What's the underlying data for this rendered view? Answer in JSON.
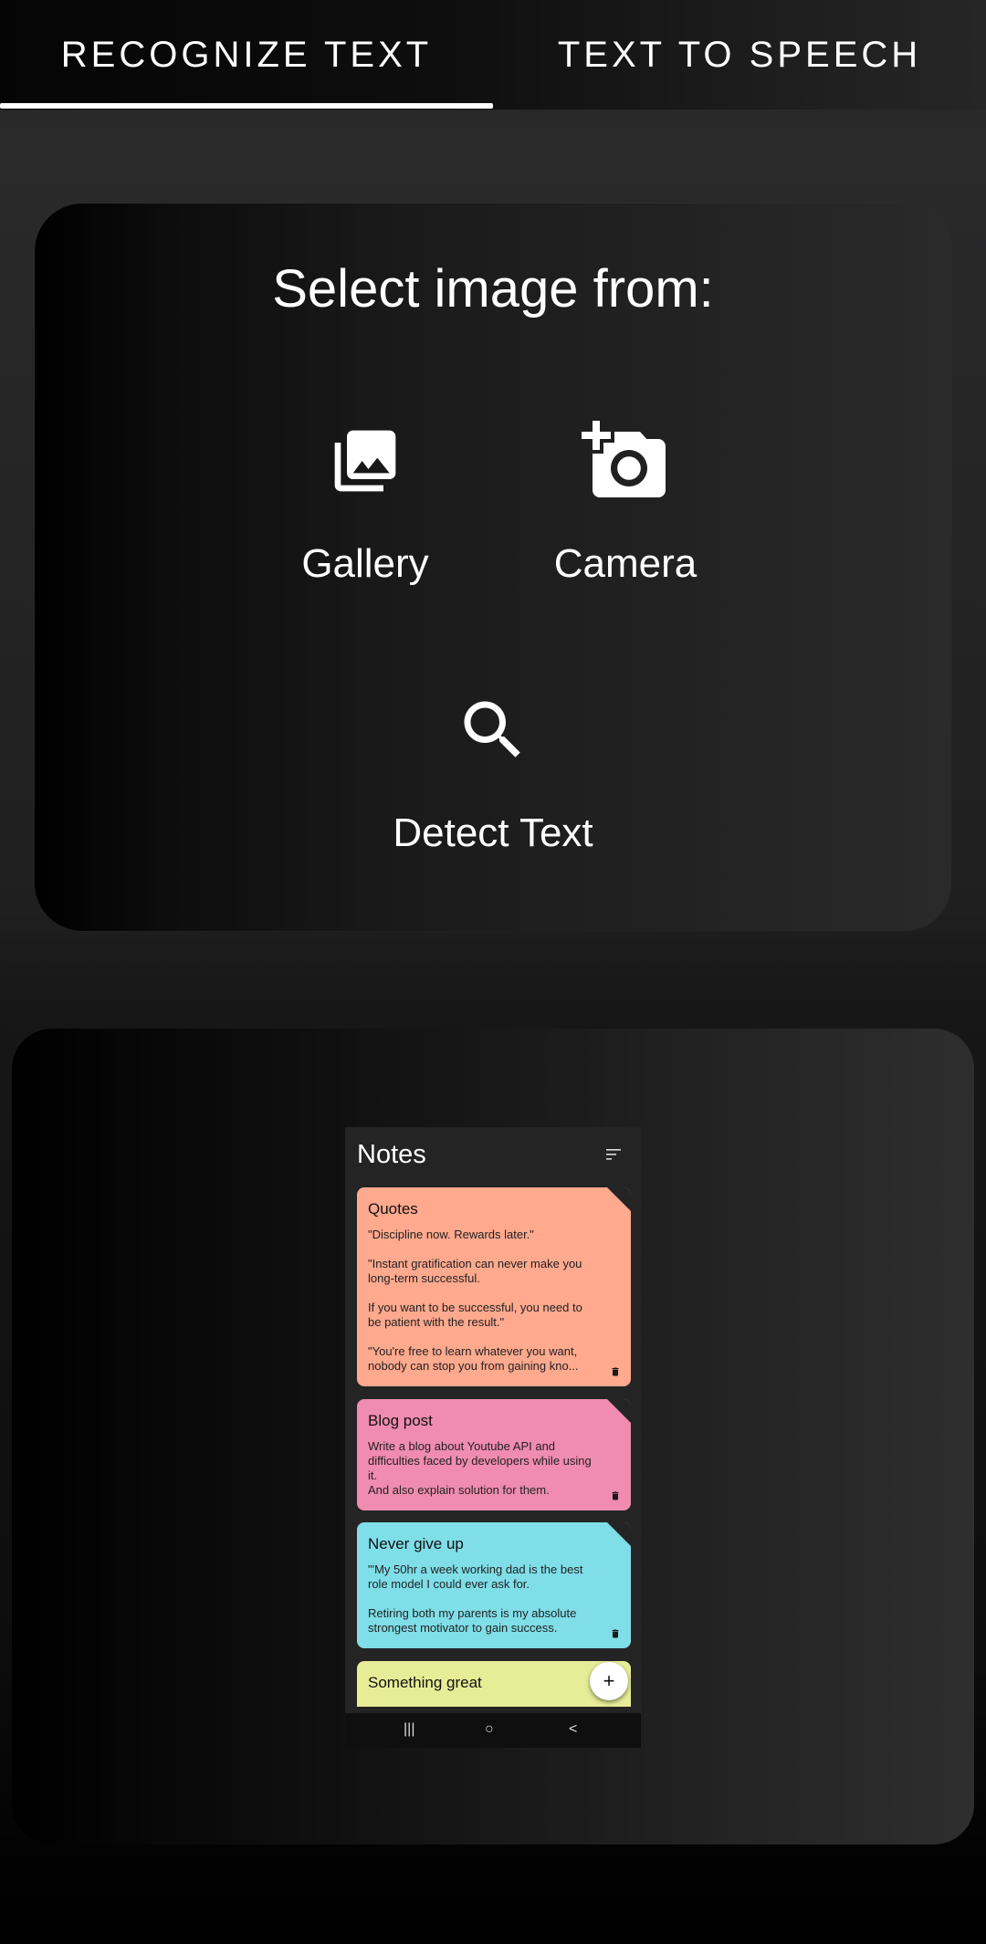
{
  "tabs": [
    {
      "label": "RECOGNIZE TEXT",
      "active": true
    },
    {
      "label": "TEXT TO SPEECH",
      "active": false
    }
  ],
  "select_card": {
    "title": "Select image from:",
    "options": [
      {
        "label": "Gallery",
        "icon": "gallery-icon"
      },
      {
        "label": "Camera",
        "icon": "add-camera-icon"
      },
      {
        "label": "Detect Text",
        "icon": "search-icon"
      }
    ]
  },
  "preview": {
    "app_title": "Notes",
    "notes": [
      {
        "title": "Quotes",
        "body": " \"Discipline now. Rewards later.\"\n\n \"Instant gratification can never make you long-term successful.\n\nIf you want to be successful, you need to be patient with the result.\"\n\n\"You're free to learn whatever you want, nobody can stop you from gaining kno...",
        "color": "#ffa98e"
      },
      {
        "title": "Blog post",
        "body": "Write a blog about Youtube API and difficulties faced by developers while using it.\nAnd also explain solution for them.",
        "color": "#f08caf"
      },
      {
        "title": "Never give up",
        "body": "\"'My 50hr a week working dad is the best role model I could ever ask for.\n\nRetiring both my parents is my absolute strongest motivator to gain success.",
        "color": "#7fdee8"
      },
      {
        "title": "Something great",
        "body": "",
        "color": "#e7ed96"
      }
    ],
    "fab_label": "+",
    "nav": {
      "recents": "|||",
      "home": "○",
      "back": "<"
    }
  },
  "colors": {
    "tab_indicator": "#ffffff",
    "accent_text": "#ffffff"
  }
}
